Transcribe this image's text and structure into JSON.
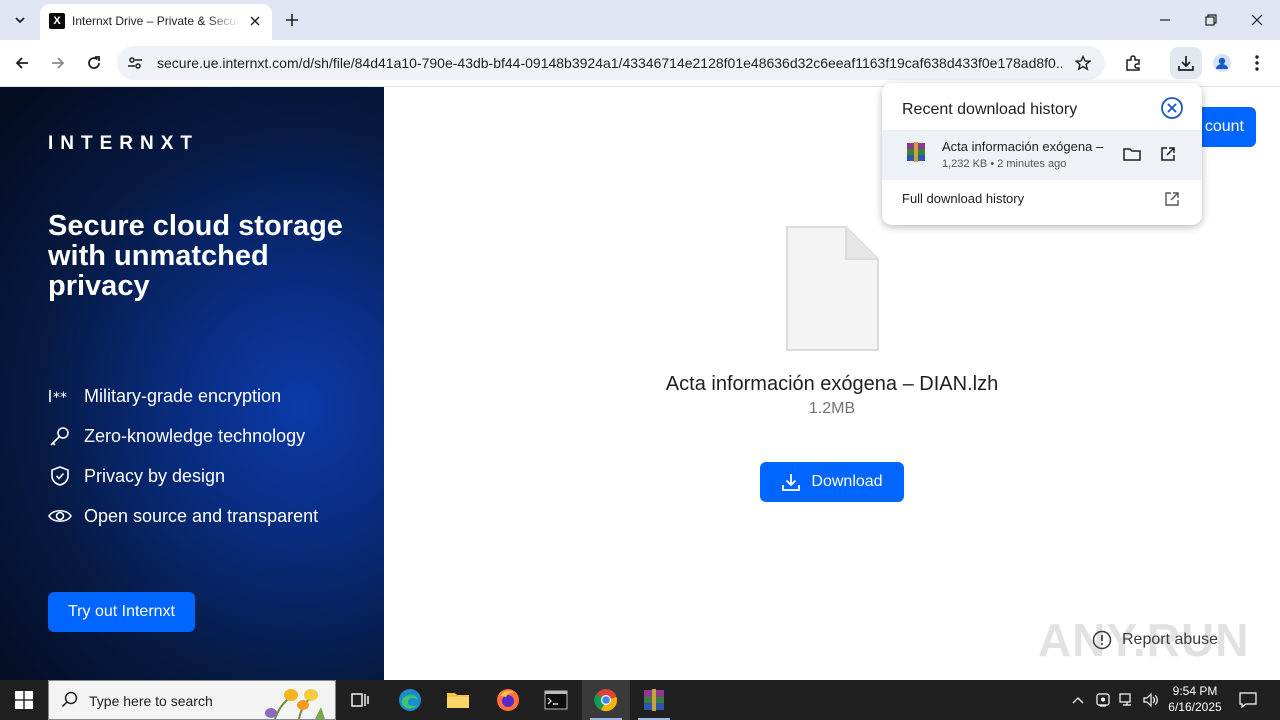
{
  "browser": {
    "tab": {
      "title": "Internxt Drive – Private & Secure Cloud Storage",
      "favicon_letter": "X"
    },
    "address": "secure.ue.internxt.com/d/sh/file/84d41a10-790e-43db-bf44-09148b3924a1/43346714e2128f01e48636d32c6eeaf1163f19caf638d433f0e178ad8f0..."
  },
  "promo": {
    "brand": "INTERNXT",
    "headline": "Secure cloud storage with unmatched privacy",
    "features": [
      {
        "icon": "password-icon",
        "label": "Military-grade encryption"
      },
      {
        "icon": "key-icon",
        "label": "Zero-knowledge technology"
      },
      {
        "icon": "shield-check-icon",
        "label": "Privacy by design"
      },
      {
        "icon": "eye-icon",
        "label": "Open source and transparent"
      }
    ],
    "cta_label": "Try out Internxt"
  },
  "main": {
    "account_button": "count",
    "file_name": "Acta información exógena – DIAN.lzh",
    "file_size": "1.2MB",
    "download_label": "Download",
    "report_label": "Report abuse",
    "watermark": "ANY.RUN"
  },
  "downloads": {
    "title": "Recent download history",
    "item": {
      "name": "Acta información exógena –",
      "meta": "1,232 KB • 2 minutes ago"
    },
    "full_history": "Full download history"
  },
  "taskbar": {
    "search_placeholder": "Type here to search",
    "time": "9:54 PM",
    "date": "6/16/2025"
  },
  "colors": {
    "accent": "#0066ff",
    "promo_bg": "#061a44",
    "taskbar": "#202020"
  }
}
